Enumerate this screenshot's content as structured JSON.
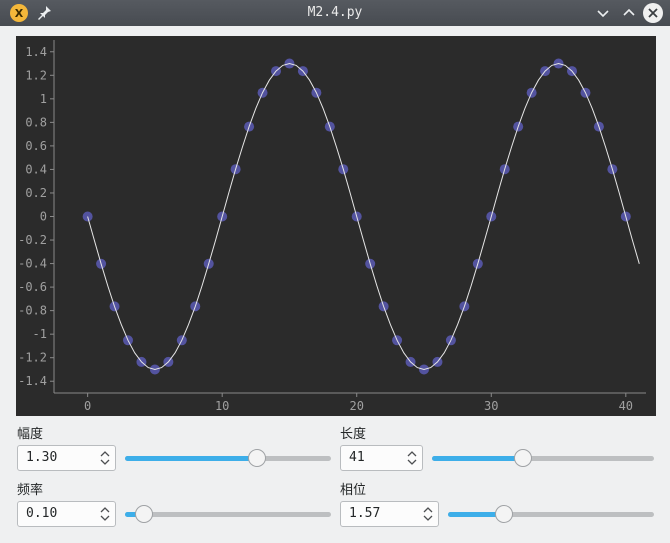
{
  "window": {
    "title": "M2.4.py",
    "app_icon_glyph": "X",
    "icons": [
      "app-icon",
      "pin-icon",
      "minimize-icon",
      "maximize-icon",
      "close-icon"
    ]
  },
  "controls": {
    "amplitude": {
      "label": "幅度",
      "value": "1.30",
      "fraction": 0.64
    },
    "length": {
      "label": "长度",
      "value": "41",
      "fraction": 0.41
    },
    "frequency": {
      "label": "频率",
      "value": "0.10",
      "fraction": 0.09
    },
    "phase": {
      "label": "相位",
      "value": "1.57",
      "fraction": 0.27
    }
  },
  "chart_data": {
    "type": "line",
    "background": "#2b2b2b",
    "line_color": "#e6e6e6",
    "marker_color": "#5a5ab4",
    "xlim": [
      -2.5,
      41.5
    ],
    "ylim": [
      -1.5,
      1.5
    ],
    "x_ticks": [
      "0",
      "10",
      "20",
      "30",
      "40"
    ],
    "y_ticks": [
      "1.4",
      "1.2",
      "1",
      "0.8",
      "0.6",
      "0.4",
      "0.2",
      "0",
      "-0.2",
      "-0.4",
      "-0.6",
      "-0.8",
      "-1",
      "-1.2",
      "-1.4"
    ],
    "series": [
      {
        "kind": "line",
        "x": [
          0,
          0.5,
          1,
          1.5,
          2,
          2.5,
          3,
          3.5,
          4,
          4.5,
          5,
          5.5,
          6,
          6.5,
          7,
          7.5,
          8,
          8.5,
          9,
          9.5,
          10,
          10.5,
          11,
          11.5,
          12,
          12.5,
          13,
          13.5,
          14,
          14.5,
          15,
          15.5,
          16,
          16.5,
          17,
          17.5,
          18,
          18.5,
          19,
          19.5,
          20,
          20.5,
          21,
          21.5,
          22,
          22.5,
          23,
          23.5,
          24,
          24.5,
          25,
          25.5,
          26,
          26.5,
          27,
          27.5,
          28,
          28.5,
          29,
          29.5,
          30,
          30.5,
          31,
          31.5,
          32,
          32.5,
          33,
          33.5,
          34,
          34.5,
          35,
          35.5,
          36,
          36.5,
          37,
          37.5,
          38,
          38.5,
          39,
          39.5,
          40,
          40.5,
          41
        ],
        "y": [
          0.0,
          -0.204,
          -0.402,
          -0.59,
          -0.764,
          -0.919,
          -1.052,
          -1.158,
          -1.236,
          -1.284,
          -1.3,
          -1.284,
          -1.236,
          -1.158,
          -1.052,
          -0.919,
          -0.764,
          -0.59,
          -0.402,
          -0.204,
          0.0,
          0.204,
          0.402,
          0.59,
          0.764,
          0.919,
          1.052,
          1.158,
          1.236,
          1.284,
          1.3,
          1.284,
          1.236,
          1.158,
          1.052,
          0.919,
          0.764,
          0.59,
          0.402,
          0.204,
          0.0,
          -0.204,
          -0.402,
          -0.59,
          -0.764,
          -0.919,
          -1.052,
          -1.158,
          -1.236,
          -1.284,
          -1.3,
          -1.284,
          -1.236,
          -1.158,
          -1.052,
          -0.919,
          -0.764,
          -0.59,
          -0.402,
          -0.204,
          0.0,
          0.204,
          0.402,
          0.59,
          0.764,
          0.919,
          1.052,
          1.158,
          1.236,
          1.284,
          1.3,
          1.284,
          1.236,
          1.158,
          1.052,
          0.919,
          0.764,
          0.59,
          0.402,
          0.204,
          0.0,
          -0.204,
          -0.402
        ]
      },
      {
        "kind": "scatter",
        "x": [
          0,
          1,
          2,
          3,
          4,
          5,
          6,
          7,
          8,
          9,
          10,
          11,
          12,
          13,
          14,
          15,
          16,
          17,
          18,
          19,
          20,
          21,
          22,
          23,
          24,
          25,
          26,
          27,
          28,
          29,
          30,
          31,
          32,
          33,
          34,
          35,
          36,
          37,
          38,
          39,
          40
        ],
        "y": [
          0.0,
          -0.402,
          -0.764,
          -1.052,
          -1.236,
          -1.3,
          -1.236,
          -1.052,
          -0.764,
          -0.402,
          0.0,
          0.402,
          0.764,
          1.052,
          1.236,
          1.3,
          1.236,
          1.052,
          0.764,
          0.402,
          0.0,
          -0.402,
          -0.764,
          -1.052,
          -1.236,
          -1.3,
          -1.236,
          -1.052,
          -0.764,
          -0.402,
          0.0,
          0.402,
          0.764,
          1.052,
          1.236,
          1.3,
          1.236,
          1.052,
          0.764,
          0.402,
          0.0
        ]
      }
    ]
  }
}
